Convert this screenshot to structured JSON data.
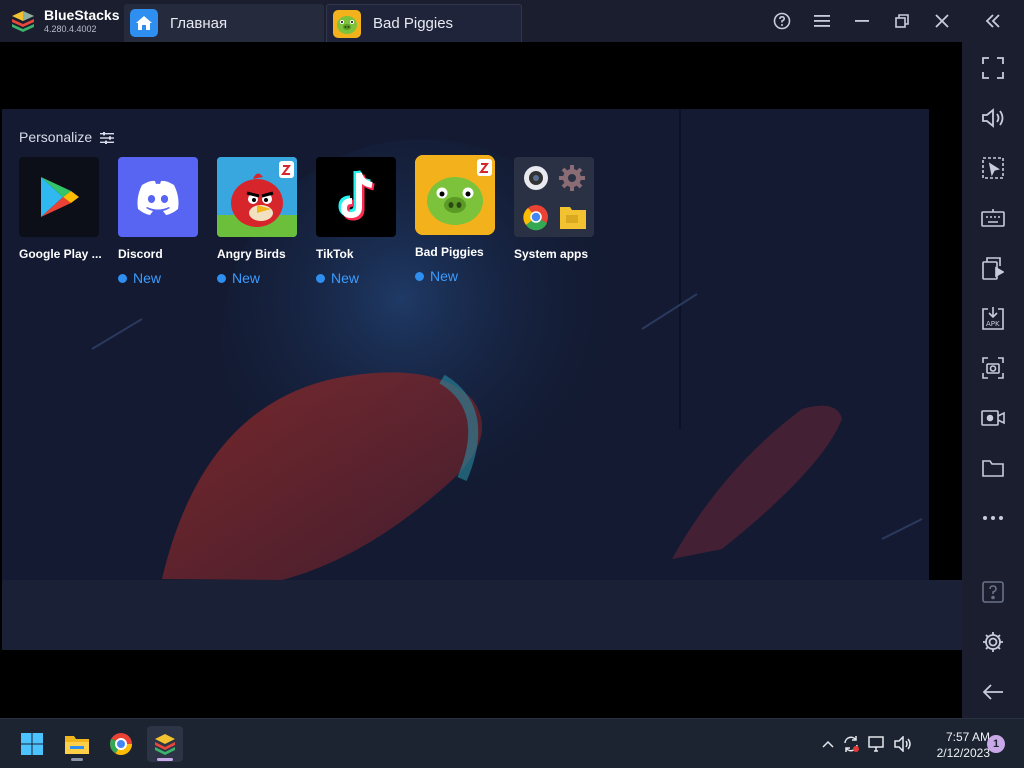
{
  "titlebar": {
    "brand_name": "BlueStacks",
    "brand_version": "4.280.4.4002",
    "tabs": [
      {
        "label": "Главная",
        "icon": "home-icon"
      },
      {
        "label": "Bad Piggies",
        "icon": "bad-piggies-icon"
      }
    ],
    "controls": [
      "help-icon",
      "menu-icon",
      "minimize-icon",
      "restore-icon",
      "close-icon",
      "collapse-sidebar-icon"
    ]
  },
  "home": {
    "section_title": "Personalize",
    "apps": [
      {
        "name": "Google Play ...",
        "new_label": ""
      },
      {
        "name": "Discord",
        "new_label": "New"
      },
      {
        "name": "Angry Birds",
        "new_label": "New"
      },
      {
        "name": "TikTok",
        "new_label": "New"
      },
      {
        "name": "Bad Piggies",
        "new_label": "New"
      },
      {
        "name": "System apps",
        "new_label": ""
      }
    ]
  },
  "sidebar": {
    "items": [
      "fullscreen-icon",
      "volume-icon",
      "select-area-icon",
      "keyboard-icon",
      "multi-instance-icon",
      "install-apk-icon",
      "screenshot-icon",
      "record-icon",
      "folder-icon",
      "more-icon",
      "help-icon",
      "settings-icon",
      "back-icon"
    ]
  },
  "taskbar": {
    "apps": [
      "windows-start-icon",
      "file-explorer-icon",
      "chrome-icon",
      "bluestacks-icon"
    ],
    "time": "7:57 AM",
    "date": "2/12/2023",
    "notification_count": "1"
  },
  "colors": {
    "chrome_bg": "#1b1e2e",
    "accent_blue": "#2e8ff0",
    "discord": "#5865f2"
  }
}
